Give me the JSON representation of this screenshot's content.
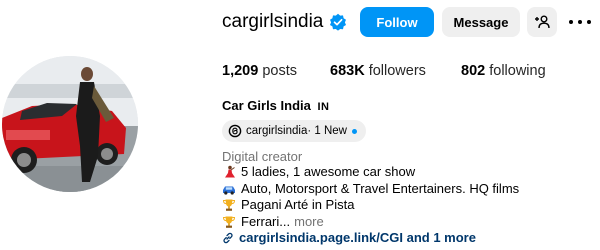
{
  "profile": {
    "username": "cargirlsindia",
    "full_name": "Car Girls India",
    "name_badge": "IN",
    "verified": true
  },
  "actions": {
    "follow_label": "Follow",
    "message_label": "Message",
    "suggest_icon": "add-person-icon",
    "more_icon": "more-options-icon"
  },
  "stats": {
    "posts_count": "1,209",
    "posts_label": "posts",
    "followers_count": "683K",
    "followers_label": "followers",
    "following_count": "802",
    "following_label": "following"
  },
  "threads": {
    "handle": "cargirlsindia",
    "suffix": " · 1 New"
  },
  "category": "Digital creator",
  "bio": {
    "line1": "5 ladies, 1 awesome car show",
    "line2": "Auto, Motorsport & Travel Entertainers. HQ films",
    "line3": "Pagani Arté in Pista",
    "line4": "Ferrari...",
    "more": "more"
  },
  "link": {
    "text": "cargirlsindia.page.link/CGI and 1 more"
  },
  "colors": {
    "accent": "#0095f6",
    "link": "#00376b",
    "secondary_text": "#737373",
    "button_bg": "#efefef"
  }
}
